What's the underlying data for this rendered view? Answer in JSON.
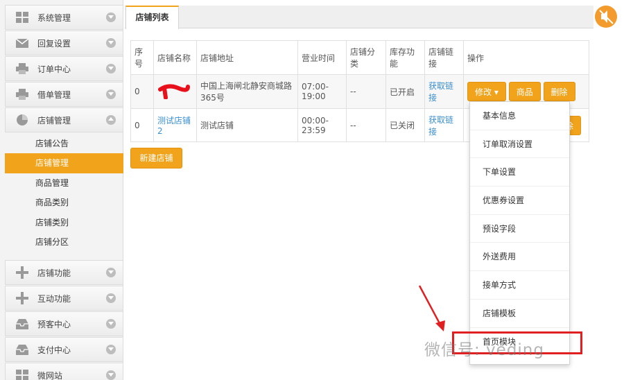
{
  "sidebar": {
    "items": [
      {
        "label": "系统管理",
        "icon": "grid-icon"
      },
      {
        "label": "回复设置",
        "icon": "envelope-icon"
      },
      {
        "label": "订单中心",
        "icon": "printer-icon"
      },
      {
        "label": "借单管理",
        "icon": "printer-icon"
      },
      {
        "label": "店铺管理",
        "icon": "pie-chart-icon"
      },
      {
        "label": "店铺功能",
        "icon": "plus-icon"
      },
      {
        "label": "互动功能",
        "icon": "plus-icon"
      },
      {
        "label": "预客中心",
        "icon": "inbox-icon"
      },
      {
        "label": "支付中心",
        "icon": "inbox-icon"
      },
      {
        "label": "微网站",
        "icon": "grid-icon"
      }
    ],
    "submenu": [
      "店铺公告",
      "店铺管理",
      "商品管理",
      "商品类别",
      "店铺类别",
      "店铺分区"
    ],
    "active_submenu": "店铺管理"
  },
  "tab": {
    "label": "店铺列表"
  },
  "table": {
    "headers": [
      "序号",
      "店铺名称",
      "店铺地址",
      "营业时间",
      "店铺分类",
      "库存功能",
      "店铺链接",
      "操作"
    ],
    "rows": [
      {
        "no": "0",
        "name": "",
        "address": "中国上海闸北静安商城路365号",
        "hours": "07:00-19:00",
        "category": "--",
        "stock": "已开启",
        "link": "获取链接"
      },
      {
        "no": "0",
        "name": "测试店铺2",
        "address": "测试店铺",
        "hours": "00:00-23:59",
        "category": "--",
        "stock": "已关闭",
        "link": "获取链接"
      }
    ],
    "actions": {
      "edit": "修改",
      "goods": "商品",
      "delete": "删除"
    }
  },
  "new_store_button": "新建店铺",
  "dropdown": [
    "基本信息",
    "订单取消设置",
    "下单设置",
    "优惠券设置",
    "预设字段",
    "外送费用",
    "接单方式",
    "店铺模板",
    "首页模块"
  ],
  "watermark": "微信号: veding",
  "colors": {
    "accent": "#f0a31b",
    "link": "#3b8fd1",
    "highlight": "#e02020"
  }
}
